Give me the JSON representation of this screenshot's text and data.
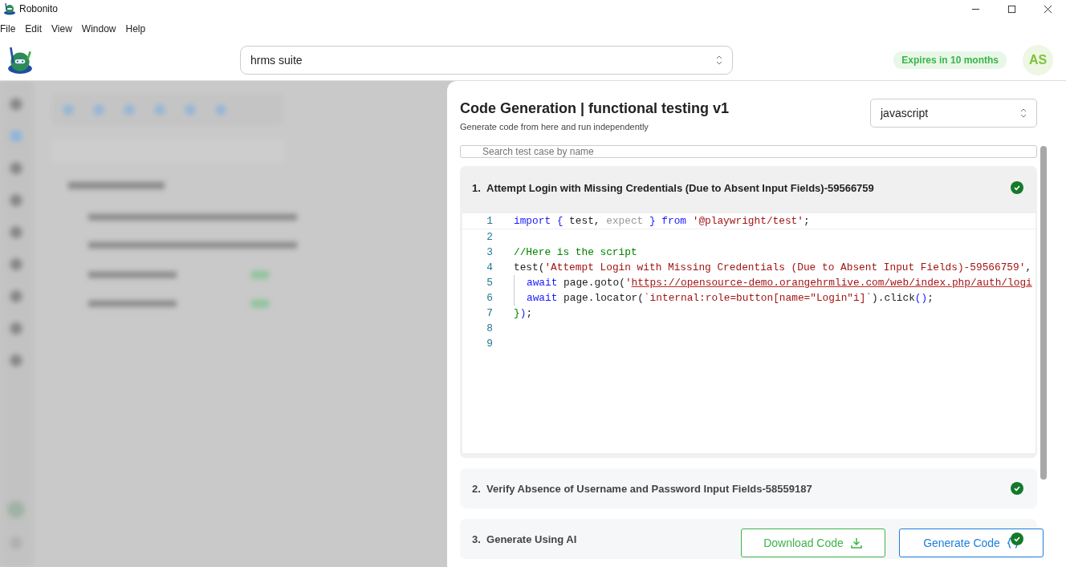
{
  "window": {
    "title": "Robonito"
  },
  "menu": [
    "File",
    "Edit",
    "View",
    "Window",
    "Help"
  ],
  "header": {
    "suite": "hrms suite",
    "license": "Expires in 10 months",
    "avatar": "AS"
  },
  "panel": {
    "title": "Code Generation | functional testing v1",
    "subtitle": "Generate code from here and run independently",
    "language": "javascript",
    "search": {
      "placeholder": "Search test case by name"
    },
    "test_cases": [
      {
        "number": "1.",
        "name": "Attempt Login with Missing Credentials (Due to Absent Input Fields)-59566759",
        "expanded": true,
        "passed": true,
        "code": [
          {
            "number": "1",
            "tokens": [
              {
                "kind": "keyword",
                "text": "import {"
              },
              {
                "kind": "plain",
                "text": " test, "
              },
              {
                "kind": "muted",
                "text": "expect"
              },
              {
                "kind": "keyword",
                "text": " } from"
              },
              {
                "kind": "string",
                "text": " '@playwright/test'"
              },
              {
                "kind": "plain",
                "text": ";"
              }
            ]
          },
          {
            "number": "2"
          },
          {
            "number": "3",
            "tokens": [
              {
                "kind": "comment",
                "text": "//Here is the script"
              }
            ]
          },
          {
            "number": "4",
            "tokens": [
              {
                "kind": "plain",
                "text": "test("
              },
              {
                "kind": "string",
                "text": "'Attempt Login with Missing Credentials (Due to Absent Input Fields)-59566759'"
              },
              {
                "kind": "plain",
                "text": ","
              }
            ]
          },
          {
            "number": "5",
            "indented": true,
            "tokens": [
              {
                "kind": "keyword",
                "text": "await"
              },
              {
                "kind": "plain",
                "text": " page.goto("
              },
              {
                "kind": "string",
                "text": "'"
              },
              {
                "kind": "link",
                "text": "https://opensource-demo.orangehrmlive.com/web/index.php/auth/logi"
              }
            ]
          },
          {
            "number": "6",
            "indented": true,
            "tokens": [
              {
                "kind": "keyword",
                "text": "await"
              },
              {
                "kind": "plain",
                "text": " page.locator("
              },
              {
                "kind": "string",
                "text": "`internal:role=button[name=\"Login\"i]`"
              },
              {
                "kind": "plain",
                "text": ").click"
              },
              {
                "kind": "keyword",
                "text": "()"
              },
              {
                "kind": "plain",
                "text": ";"
              }
            ]
          },
          {
            "number": "7",
            "tokens": [
              {
                "kind": "comment",
                "text": "}"
              },
              {
                "kind": "keyword",
                "text": ")"
              },
              {
                "kind": "plain",
                "text": ";"
              }
            ]
          },
          {
            "number": "8"
          },
          {
            "number": "9"
          }
        ]
      },
      {
        "number": "2.",
        "name": "Verify Absence of Username and Password Input Fields-58559187",
        "expanded": false,
        "passed": true
      },
      {
        "number": "3.",
        "name": "Generate Using AI",
        "expanded": false,
        "passed": true
      }
    ],
    "buttons": [
      {
        "kind": "download",
        "label": "Download Code"
      },
      {
        "kind": "generate",
        "label": "Generate Code"
      }
    ]
  }
}
